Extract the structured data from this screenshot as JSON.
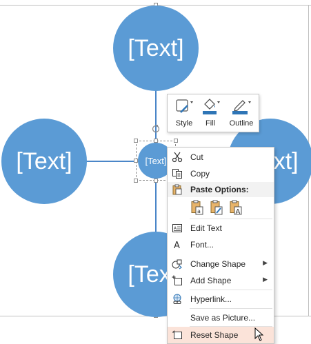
{
  "diagram": {
    "center_label": "[Text]",
    "top_label": "[Text]",
    "left_label": "[Text]",
    "right_label": "[Text]",
    "bottom_label": "[Text]",
    "colors": {
      "circle": "#5b9bd5",
      "line": "#4a86c8"
    }
  },
  "mini_toolbar": {
    "style_label": "Style",
    "fill_label": "Fill",
    "outline_label": "Outline"
  },
  "context_menu": {
    "cut": "Cut",
    "copy": "Copy",
    "paste_options_header": "Paste Options:",
    "edit_text": "Edit Text",
    "font": "Font...",
    "change_shape": "Change Shape",
    "add_shape": "Add Shape",
    "hyperlink": "Hyperlink...",
    "save_as_picture": "Save as Picture...",
    "reset_shape": "Reset Shape",
    "highlight_color": "#fbe3d9"
  }
}
